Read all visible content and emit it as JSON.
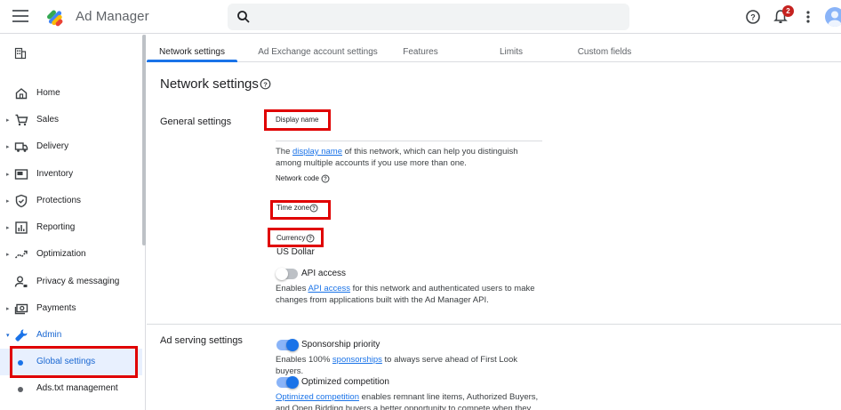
{
  "app": {
    "title": "Ad Manager"
  },
  "header": {
    "search_placeholder": "",
    "notification_count": "2"
  },
  "sidebar": {
    "items": [
      {
        "label": "Home",
        "icon": "home-icon"
      },
      {
        "label": "Sales",
        "icon": "cart-icon"
      },
      {
        "label": "Delivery",
        "icon": "truck-icon"
      },
      {
        "label": "Inventory",
        "icon": "inventory-icon"
      },
      {
        "label": "Protections",
        "icon": "shield-icon"
      },
      {
        "label": "Reporting",
        "icon": "bar-chart-icon"
      },
      {
        "label": "Optimization",
        "icon": "trend-icon"
      },
      {
        "label": "Privacy & messaging",
        "icon": "person-icon"
      },
      {
        "label": "Payments",
        "icon": "payments-icon"
      },
      {
        "label": "Admin",
        "icon": "wrench-icon"
      },
      {
        "label": "Global settings",
        "icon": "dot"
      },
      {
        "label": "Ads.txt management",
        "icon": "dot"
      }
    ]
  },
  "tabs": [
    {
      "label": "Network settings"
    },
    {
      "label": "Ad Exchange account settings"
    },
    {
      "label": "Features"
    },
    {
      "label": "Limits"
    },
    {
      "label": "Custom fields"
    }
  ],
  "main": {
    "title": "Network settings",
    "general_settings": {
      "label": "General settings",
      "display_name_label": "Display name",
      "display_name_desc_pre": "The ",
      "display_name_link": "display name",
      "display_name_desc_post": " of this network, which can help you distinguish among multiple accounts if you use more than one.",
      "network_code_label": "Network code",
      "time_zone_label": "Time zone",
      "currency_label": "Currency",
      "currency_value": "US Dollar",
      "api_access_label": "API access",
      "api_desc_pre": "Enables ",
      "api_desc_link": "API access",
      "api_desc_post": " for this network and authenticated users to make changes from applications built with the Ad Manager API."
    },
    "ad_serving": {
      "label": "Ad serving settings",
      "sponsorship_label": "Sponsorship priority",
      "sponsorship_desc_pre": "Enables 100% ",
      "sponsorship_desc_link": "sponsorships",
      "sponsorship_desc_post": " to always serve ahead of First Look buyers.",
      "optimized_label": "Optimized competition",
      "optimized_desc_link": "Optimized competition",
      "optimized_desc_post": " enables remnant line items, Authorized Buyers, and Open Bidding buyers a better opportunity to compete when they are willing to"
    }
  },
  "colors": {
    "accent": "#1a73e8",
    "highlight": "#e00000"
  }
}
